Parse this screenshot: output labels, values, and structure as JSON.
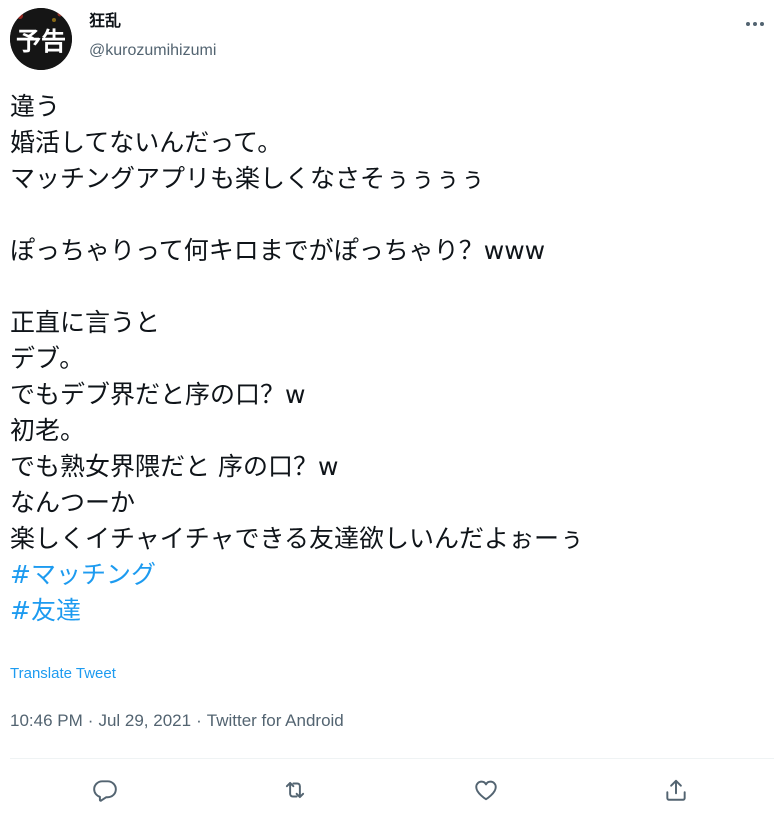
{
  "user": {
    "display_name": "狂乱",
    "handle": "@kurozumihizumi",
    "avatar_text": "予告"
  },
  "tweet": {
    "lines": [
      "違う",
      "婚活してないんだって。",
      "マッチングアプリも楽しくなさそぅぅぅぅ",
      "",
      "ぽっちゃりって何キロまでがぽっちゃり？www",
      "",
      "正直に言うと",
      "デブ。",
      "でもデブ界だと序の口？w",
      "初老。",
      "でも熟女界隈だと 序の口？w",
      "なんつーか",
      "楽しくイチャイチャできる友達欲しいんだよぉーぅ"
    ],
    "hashtags": [
      "#マッチング",
      "#友達"
    ],
    "translate_label": "Translate Tweet"
  },
  "meta": {
    "time": "10:46 PM",
    "separator": "·",
    "date": "Jul 29, 2021",
    "source": "Twitter for Android"
  },
  "actions": {
    "reply_icon": "reply-icon",
    "retweet_icon": "retweet-icon",
    "like_icon": "like-icon",
    "share_icon": "share-icon"
  },
  "colors": {
    "text": "#0f1419",
    "secondary": "#536471",
    "accent": "#1d9bf0",
    "divider": "#eff3f4"
  }
}
